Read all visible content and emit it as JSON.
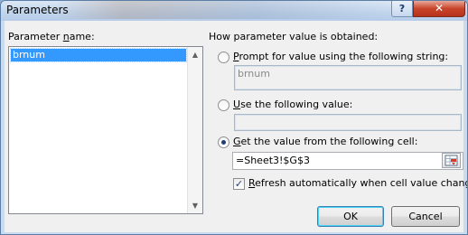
{
  "window": {
    "title": "Parameters",
    "help_glyph": "?",
    "close_glyph": "✕"
  },
  "left": {
    "label_prefix": "Parameter ",
    "label_mnemonic": "n",
    "label_suffix": "ame:",
    "items": [
      "brnum"
    ]
  },
  "right": {
    "group_label": "How parameter value is obtained:",
    "prompt_option": {
      "mnemonic": "P",
      "rest": "rompt for value using the following string:",
      "selected": false
    },
    "prompt_value": "brnum",
    "use_option": {
      "mnemonic": "U",
      "rest": "se the following value:",
      "selected": false
    },
    "use_value": "",
    "cell_option": {
      "mnemonic": "G",
      "rest": "et the value from the following cell:",
      "selected": true
    },
    "cell_value": "=Sheet3!$G$3",
    "refresh": {
      "mnemonic": "R",
      "rest": "efresh automatically when cell value changes",
      "checked": true
    }
  },
  "buttons": {
    "ok": "OK",
    "cancel": "Cancel"
  }
}
